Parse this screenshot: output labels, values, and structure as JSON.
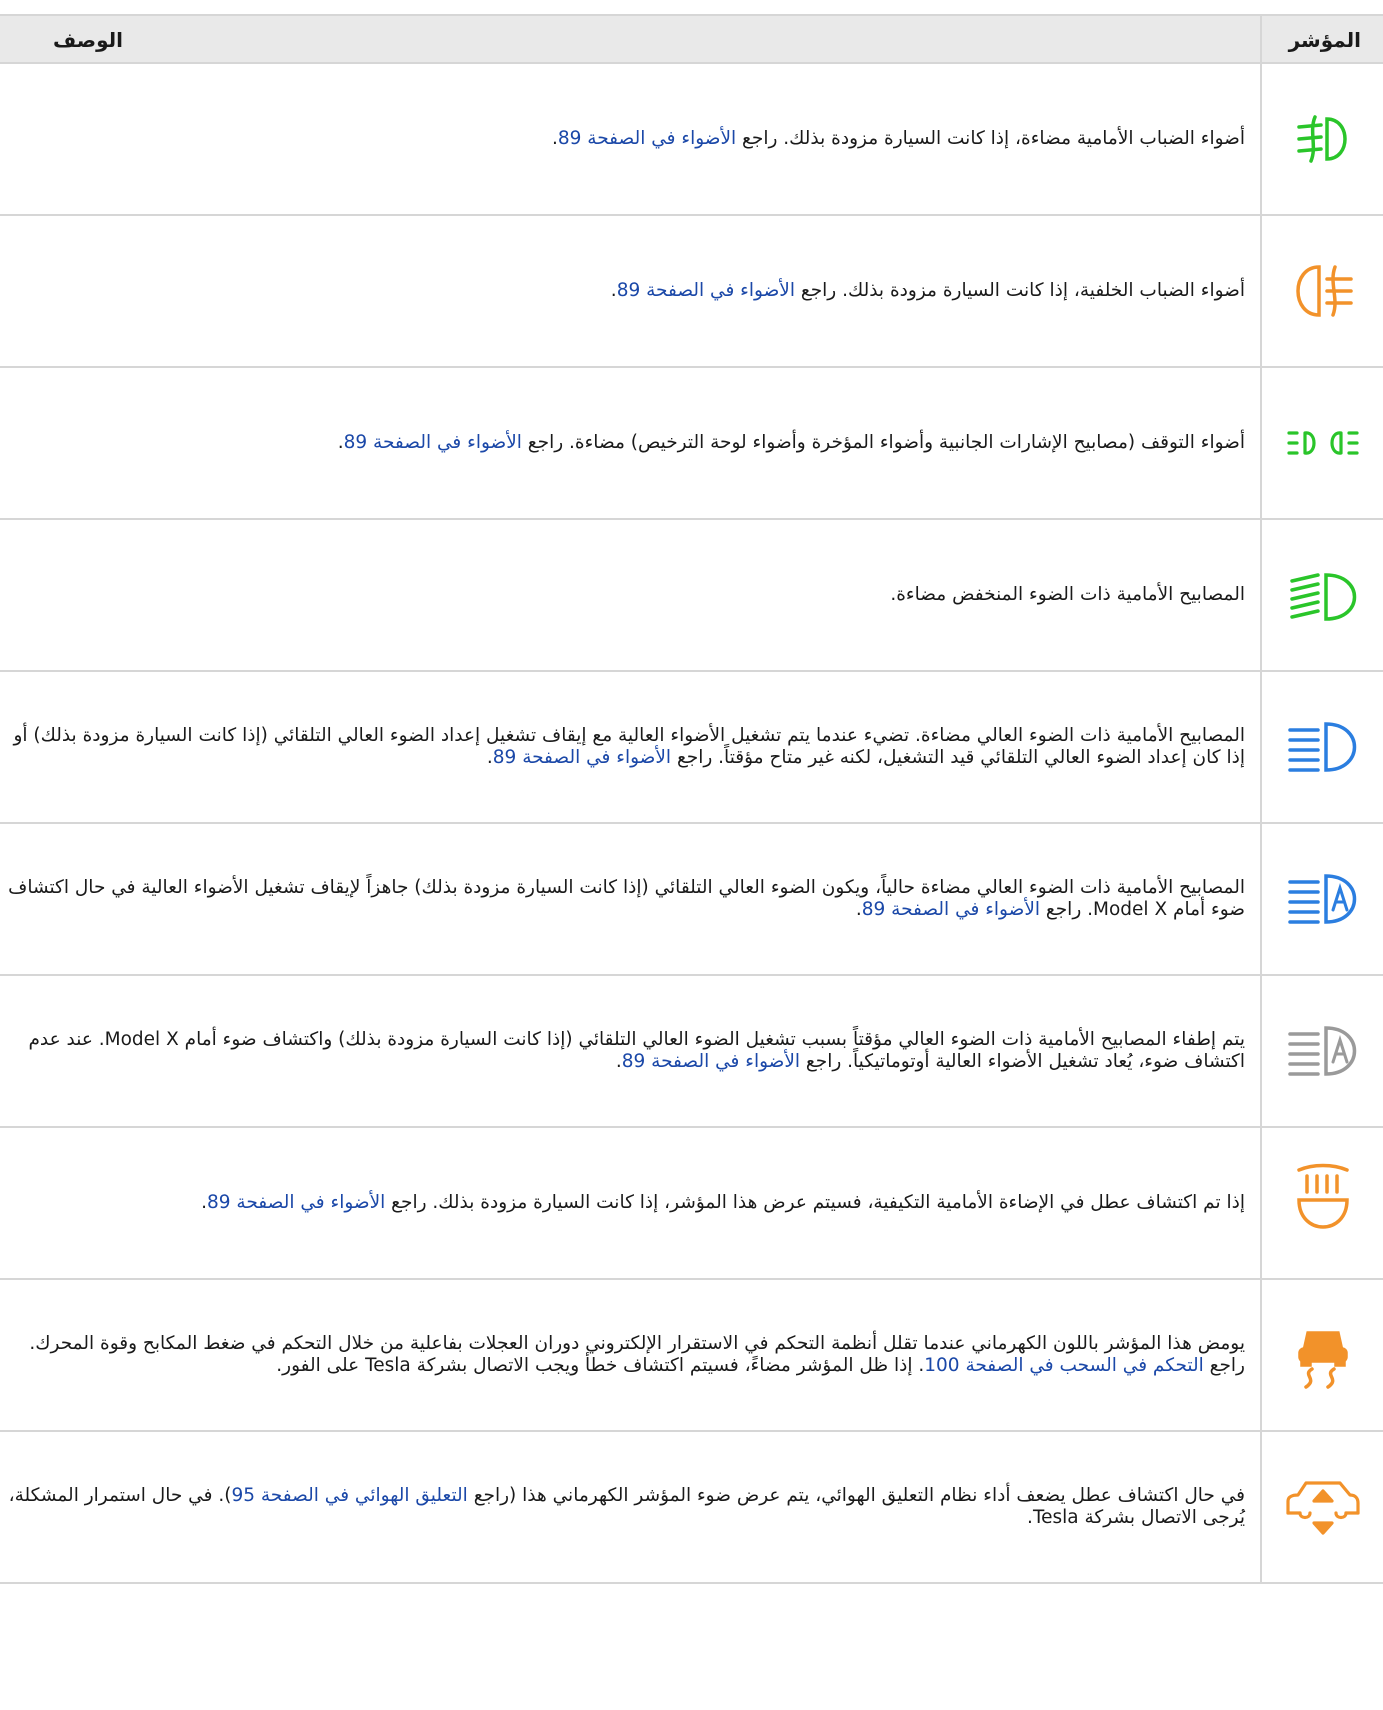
{
  "header": {
    "indicator": "المؤشر",
    "description": "الوصف"
  },
  "colors": {
    "green": "#2ac52a",
    "orange": "#f2922a",
    "blue": "#2b7ee0",
    "gray": "#9a9a9a",
    "link": "#1b48a8"
  },
  "rows": [
    {
      "icon": "front-fog-lights-icon",
      "pre": "أضواء الضباب الأمامية مضاءة، إذا كانت السيارة مزودة بذلك. راجع ",
      "link": "الأضواء في الصفحة 89",
      "post": "."
    },
    {
      "icon": "rear-fog-lights-icon",
      "pre": "أضواء الضباب الخلفية، إذا كانت السيارة مزودة بذلك. راجع ",
      "link": "الأضواء في الصفحة 89",
      "post": "."
    },
    {
      "icon": "parking-lights-icon",
      "pre": "أضواء التوقف (مصابيح الإشارات الجانبية وأضواء المؤخرة وأضواء لوحة الترخيص) مضاءة. راجع ",
      "link": "الأضواء في الصفحة 89",
      "post": "."
    },
    {
      "icon": "low-beam-icon",
      "pre": "المصابيح الأمامية ذات الضوء المنخفض مضاءة.",
      "link": "",
      "post": ""
    },
    {
      "icon": "high-beam-icon",
      "pre": "المصابيح الأمامية ذات الضوء العالي مضاءة. تضيء عندما يتم تشغيل الأضواء العالية مع إيقاف تشغيل إعداد الضوء العالي التلقائي (إذا كانت السيارة مزودة بذلك) أو إذا كان إعداد الضوء العالي التلقائي قيد التشغيل، لكنه غير متاح مؤقتاً. راجع ",
      "link": "الأضواء في الصفحة 89",
      "post": "."
    },
    {
      "icon": "auto-high-beam-on-icon",
      "pre": "المصابيح الأمامية ذات الضوء العالي مضاءة حالياً، ويكون الضوء العالي التلقائي (إذا كانت السيارة مزودة بذلك) جاهزاً لإيقاف تشغيل الأضواء العالية في حال اكتشاف ضوء أمام Model X. راجع ",
      "link": "الأضواء في الصفحة 89",
      "post": "."
    },
    {
      "icon": "auto-high-beam-off-icon",
      "pre": "يتم إطفاء المصابيح الأمامية ذات الضوء العالي مؤقتاً بسبب تشغيل الضوء العالي التلقائي (إذا كانت السيارة مزودة بذلك) واكتشاف ضوء أمام Model X. عند عدم اكتشاف ضوء، يُعاد تشغيل الأضواء العالية أوتوماتيكياً. راجع ",
      "link": "الأضواء في الصفحة 89",
      "post": "."
    },
    {
      "icon": "adaptive-lighting-fault-icon",
      "pre": "إذا تم اكتشاف عطل في الإضاءة الأمامية التكيفية، فسيتم عرض هذا المؤشر، إذا كانت السيارة مزودة بذلك. راجع ",
      "link": "الأضواء في الصفحة 89",
      "post": "."
    },
    {
      "icon": "traction-control-icon",
      "pre": "يومض هذا المؤشر باللون الكهرماني عندما تقلل أنظمة التحكم في الاستقرار الإلكتروني دوران العجلات بفاعلية من خلال التحكم في ضغط المكابح وقوة المحرك. راجع ",
      "link": "التحكم في السحب في الصفحة 100",
      "post": ". إذا ظل المؤشر مضاءً، فسيتم اكتشاف خطأ ويجب الاتصال بشركة Tesla على الفور."
    },
    {
      "icon": "air-suspension-icon",
      "pre": "في حال اكتشاف عطل يضعف أداء نظام التعليق الهوائي، يتم عرض ضوء المؤشر الكهرماني هذا (راجع ",
      "link": "التعليق الهوائي في الصفحة 95",
      "post": "). في حال استمرار المشكلة، يُرجى الاتصال بشركة Tesla."
    }
  ]
}
